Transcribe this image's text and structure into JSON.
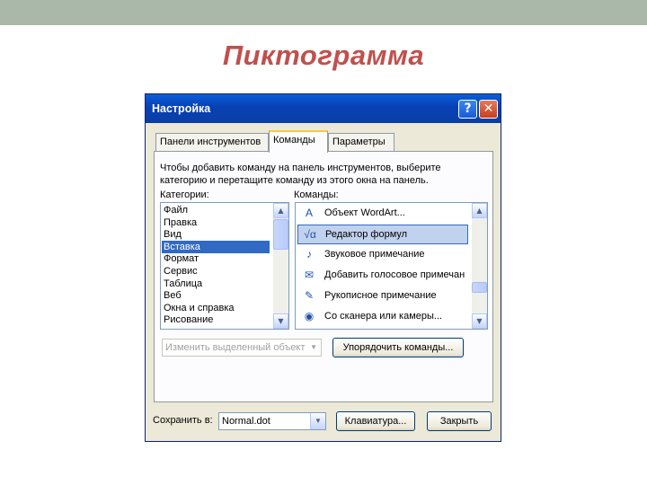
{
  "slide": {
    "title": "Пиктограмма"
  },
  "dialog": {
    "title": "Настройка",
    "help_label": "?",
    "close_label": "✕",
    "tabs": [
      {
        "label": "Панели инструментов"
      },
      {
        "label": "Команды",
        "active": true
      },
      {
        "label": "Параметры"
      }
    ],
    "instructions_line1": "Чтобы добавить команду на панель инструментов, выберите",
    "instructions_line2": "категорию и перетащите команду из этого окна на панель.",
    "categories_label": "Категории:",
    "commands_label": "Команды:",
    "categories": [
      {
        "label": "Файл"
      },
      {
        "label": "Правка"
      },
      {
        "label": "Вид"
      },
      {
        "label": "Вставка",
        "selected": true
      },
      {
        "label": "Формат"
      },
      {
        "label": "Сервис"
      },
      {
        "label": "Таблица"
      },
      {
        "label": "Веб"
      },
      {
        "label": "Окна и справка"
      },
      {
        "label": "Рисование"
      }
    ],
    "commands": [
      {
        "icon": "wordart-icon",
        "glyph": "A",
        "label": "Объект WordArt..."
      },
      {
        "icon": "formula-editor-icon",
        "glyph": "√α",
        "label": "Редактор формул",
        "selected": true
      },
      {
        "icon": "sound-note-icon",
        "glyph": "♪",
        "label": "Звуковое примечание"
      },
      {
        "icon": "voice-note-icon",
        "glyph": "✉",
        "label": "Добавить голосовое примечан"
      },
      {
        "icon": "ink-note-icon",
        "glyph": "✎",
        "label": "Рукописное примечание"
      },
      {
        "icon": "scanner-camera-icon",
        "glyph": "◉",
        "label": "Со сканера или камеры..."
      }
    ],
    "modify_selection": "Изменить выделенный объект",
    "rearrange_button": "Упорядочить команды...",
    "save_in_label": "Сохранить в:",
    "save_in_value": "Normal.dot",
    "keyboard_button": "Клавиатура...",
    "close_button": "Закрыть"
  },
  "colors": {
    "title_accent": "#c0504d",
    "titlebar": "#0a5fd8",
    "selection": "#316ac5"
  }
}
